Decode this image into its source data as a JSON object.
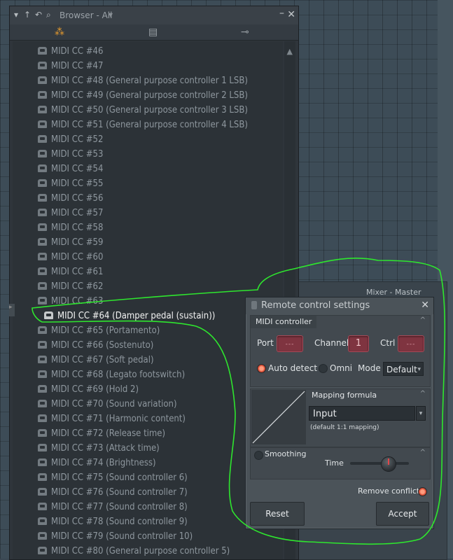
{
  "browser": {
    "title": "Browser - All",
    "list": [
      "MIDI CC #46",
      "MIDI CC #47",
      "MIDI CC #48 (General purpose controller 1 LSB)",
      "MIDI CC #49 (General purpose controller 2 LSB)",
      "MIDI CC #50 (General purpose controller 3 LSB)",
      "MIDI CC #51 (General purpose controller 4 LSB)",
      "MIDI CC #52",
      "MIDI CC #53",
      "MIDI CC #54",
      "MIDI CC #55",
      "MIDI CC #56",
      "MIDI CC #57",
      "MIDI CC #58",
      "MIDI CC #59",
      "MIDI CC #60",
      "MIDI CC #61",
      "MIDI CC #62",
      "MIDI CC #63",
      "MIDI CC #64 (Damper pedal (sustain))",
      "MIDI CC #65 (Portamento)",
      "MIDI CC #66 (Sostenuto)",
      "MIDI CC #67 (Soft pedal)",
      "MIDI CC #68 (Legato footswitch)",
      "MIDI CC #69 (Hold 2)",
      "MIDI CC #70 (Sound variation)",
      "MIDI CC #71 (Harmonic content)",
      "MIDI CC #72 (Release time)",
      "MIDI CC #73 (Attack time)",
      "MIDI CC #74 (Brightness)",
      "MIDI CC #75 (Sound controller 6)",
      "MIDI CC #76 (Sound controller 7)",
      "MIDI CC #77 (Sound controller 8)",
      "MIDI CC #78 (Sound controller 9)",
      "MIDI CC #79 (Sound controller 10)",
      "MIDI CC #80 (General purpose controller 5)"
    ],
    "selected_index": 18
  },
  "mixer": {
    "title": "Mixer - Master"
  },
  "dialog": {
    "title": "Remote control settings",
    "midi_section": "MIDI controller",
    "port_label": "Port",
    "port_value": "---",
    "channel_label": "Channel",
    "channel_value": "1",
    "ctrl_label": "Ctrl",
    "ctrl_value": "---",
    "auto_detect_label": "Auto detect",
    "omni_label": "Omni",
    "mode_label": "Mode",
    "mode_value": "Default",
    "mapping_section": "Mapping formula",
    "formula_value": "Input",
    "formula_note": "(default 1:1 mapping)",
    "smoothing_label": "Smoothing",
    "time_label": "Time",
    "remove_conflicts_label": "Remove conflicts",
    "reset_label": "Reset",
    "accept_label": "Accept"
  },
  "colors": {
    "annotation": "#2ee62e",
    "accent_red": "#7f3440"
  }
}
